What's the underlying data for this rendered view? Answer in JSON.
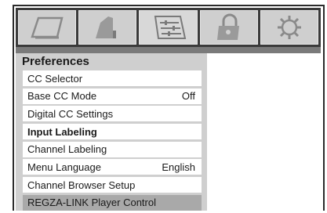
{
  "tabs": [
    {
      "icon": "picture-icon"
    },
    {
      "icon": "sound-icon"
    },
    {
      "icon": "preferences-icon",
      "active": true
    },
    {
      "icon": "lock-icon"
    },
    {
      "icon": "setup-gear-icon"
    }
  ],
  "panel": {
    "title": "Preferences"
  },
  "menu": [
    {
      "label": "CC Selector",
      "value": ""
    },
    {
      "label": "Base CC Mode",
      "value": "Off"
    },
    {
      "label": "Digital CC Settings",
      "value": ""
    },
    {
      "label": "Input Labeling",
      "value": ""
    },
    {
      "label": "Channel Labeling",
      "value": ""
    },
    {
      "label": "Menu Language",
      "value": "English"
    },
    {
      "label": "Channel Browser Setup",
      "value": ""
    },
    {
      "label": "REGZA-LINK Player Control",
      "value": ""
    }
  ]
}
